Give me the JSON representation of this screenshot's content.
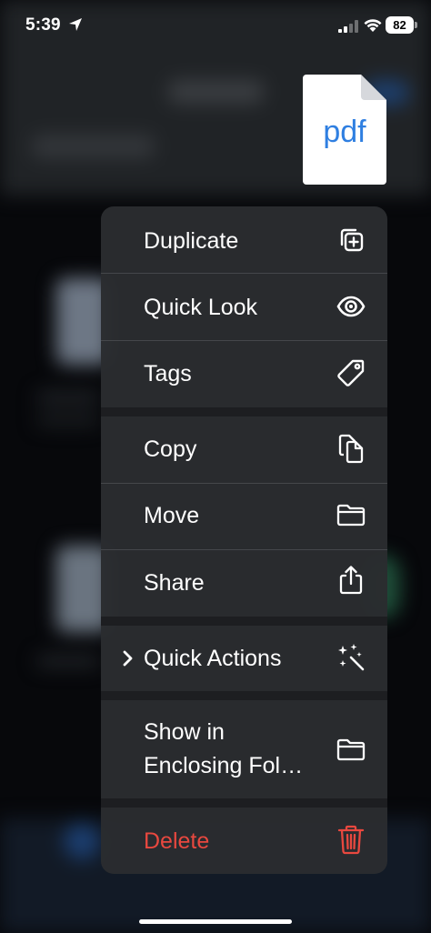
{
  "status_bar": {
    "time": "5:39",
    "battery": "82"
  },
  "file": {
    "thumbnail_label": "pdf"
  },
  "menu": {
    "items": [
      {
        "label": "Duplicate",
        "icon": "duplicate-icon"
      },
      {
        "label": "Quick Look",
        "icon": "eye-icon"
      },
      {
        "label": "Tags",
        "icon": "tag-icon"
      },
      {
        "label": "Copy",
        "icon": "copy-icon"
      },
      {
        "label": "Move",
        "icon": "folder-icon"
      },
      {
        "label": "Share",
        "icon": "share-icon"
      },
      {
        "label": "Quick Actions",
        "icon": "sparkles-wand-icon"
      },
      {
        "label_line1": "Show in",
        "label_line2": "Enclosing Fol…",
        "icon": "folder-icon"
      },
      {
        "label": "Delete",
        "icon": "trash-icon"
      }
    ]
  },
  "colors": {
    "menu_background": "#2a2c2f",
    "destructive": "#e8483f",
    "pdf_accent": "#2f7fe1"
  }
}
